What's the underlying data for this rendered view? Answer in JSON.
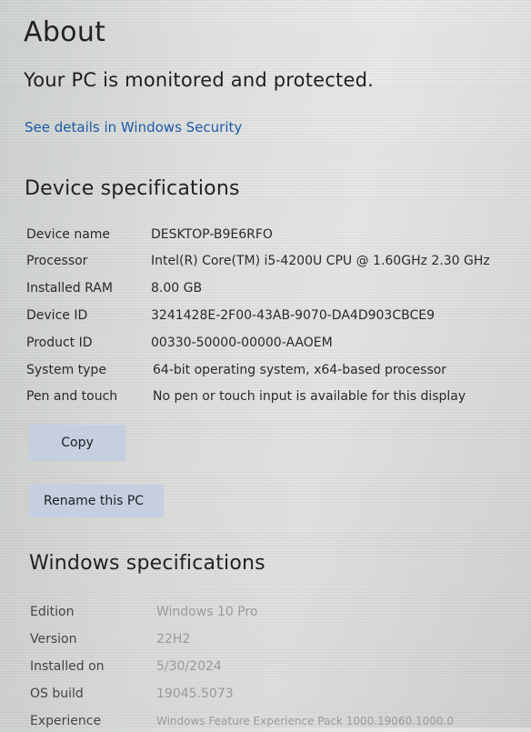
{
  "page": {
    "title": "About",
    "protection_status": "Your PC is monitored and protected.",
    "security_link": "See details in Windows Security"
  },
  "device_specs": {
    "heading": "Device specifications",
    "rows": [
      {
        "label": "Device name",
        "value": "DESKTOP-B9E6RFO"
      },
      {
        "label": "Processor",
        "value": "Intel(R) Core(TM) i5-4200U CPU @ 1.60GHz   2.30 GHz"
      },
      {
        "label": "Installed RAM",
        "value": "8.00 GB"
      },
      {
        "label": "Device ID",
        "value": "3241428E-2F00-43AB-9070-DA4D903CBCE9"
      },
      {
        "label": "Product ID",
        "value": "00330-50000-00000-AAOEM"
      },
      {
        "label": "System type",
        "value": "64-bit operating system, x64-based processor"
      },
      {
        "label": "Pen and touch",
        "value": "No pen or touch input is available for this display"
      }
    ],
    "copy_label": "Copy",
    "rename_label": "Rename this PC"
  },
  "windows_specs": {
    "heading": "Windows specifications",
    "rows": [
      {
        "label": "Edition",
        "value": "Windows 10 Pro"
      },
      {
        "label": "Version",
        "value": "22H2"
      },
      {
        "label": "Installed on",
        "value": "5/30/2024"
      },
      {
        "label": "OS build",
        "value": "19045.5073"
      },
      {
        "label": "Experience",
        "value": "Windows Feature Experience Pack 1000.19060.1000.0"
      }
    ]
  }
}
